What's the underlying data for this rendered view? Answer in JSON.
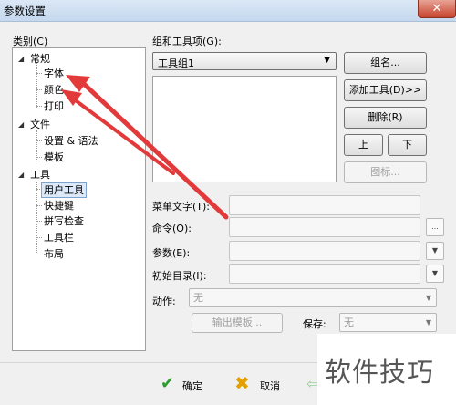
{
  "window": {
    "title": "参数设置",
    "close_glyph": "✕"
  },
  "category": {
    "label": "类别(C)",
    "groups": [
      {
        "label": "常规",
        "children": [
          "字体",
          "颜色",
          "打印"
        ]
      },
      {
        "label": "文件",
        "children": [
          "设置 & 语法",
          "模板"
        ]
      },
      {
        "label": "工具",
        "children": [
          "用户工具",
          "快捷键",
          "拼写检查",
          "工具栏",
          "布局"
        ]
      }
    ],
    "selected": "用户工具"
  },
  "toolset": {
    "label": "组和工具项(G):",
    "value": "工具组1",
    "buttons": {
      "group_name": "组名...",
      "add_tool": "添加工具(D)>>",
      "delete": "删除(R)",
      "up": "上",
      "down": "下",
      "icon": "图标..."
    }
  },
  "fields": {
    "menu_text": "菜单文字(T):",
    "command": "命令(O):",
    "params": "参数(E):",
    "init_dir": "初始目录(I):",
    "browse": "...",
    "arrow": "▼"
  },
  "action": {
    "label": "动作:",
    "value": "无"
  },
  "output_template": {
    "label": "输出模板..."
  },
  "save": {
    "label": "保存:",
    "value": "无"
  },
  "footer": {
    "ok": "确定",
    "cancel": "取消"
  },
  "watermark": "软件技巧",
  "colors": {
    "arrow": "#e23a3a",
    "selected_bg": "#dde9f8"
  }
}
